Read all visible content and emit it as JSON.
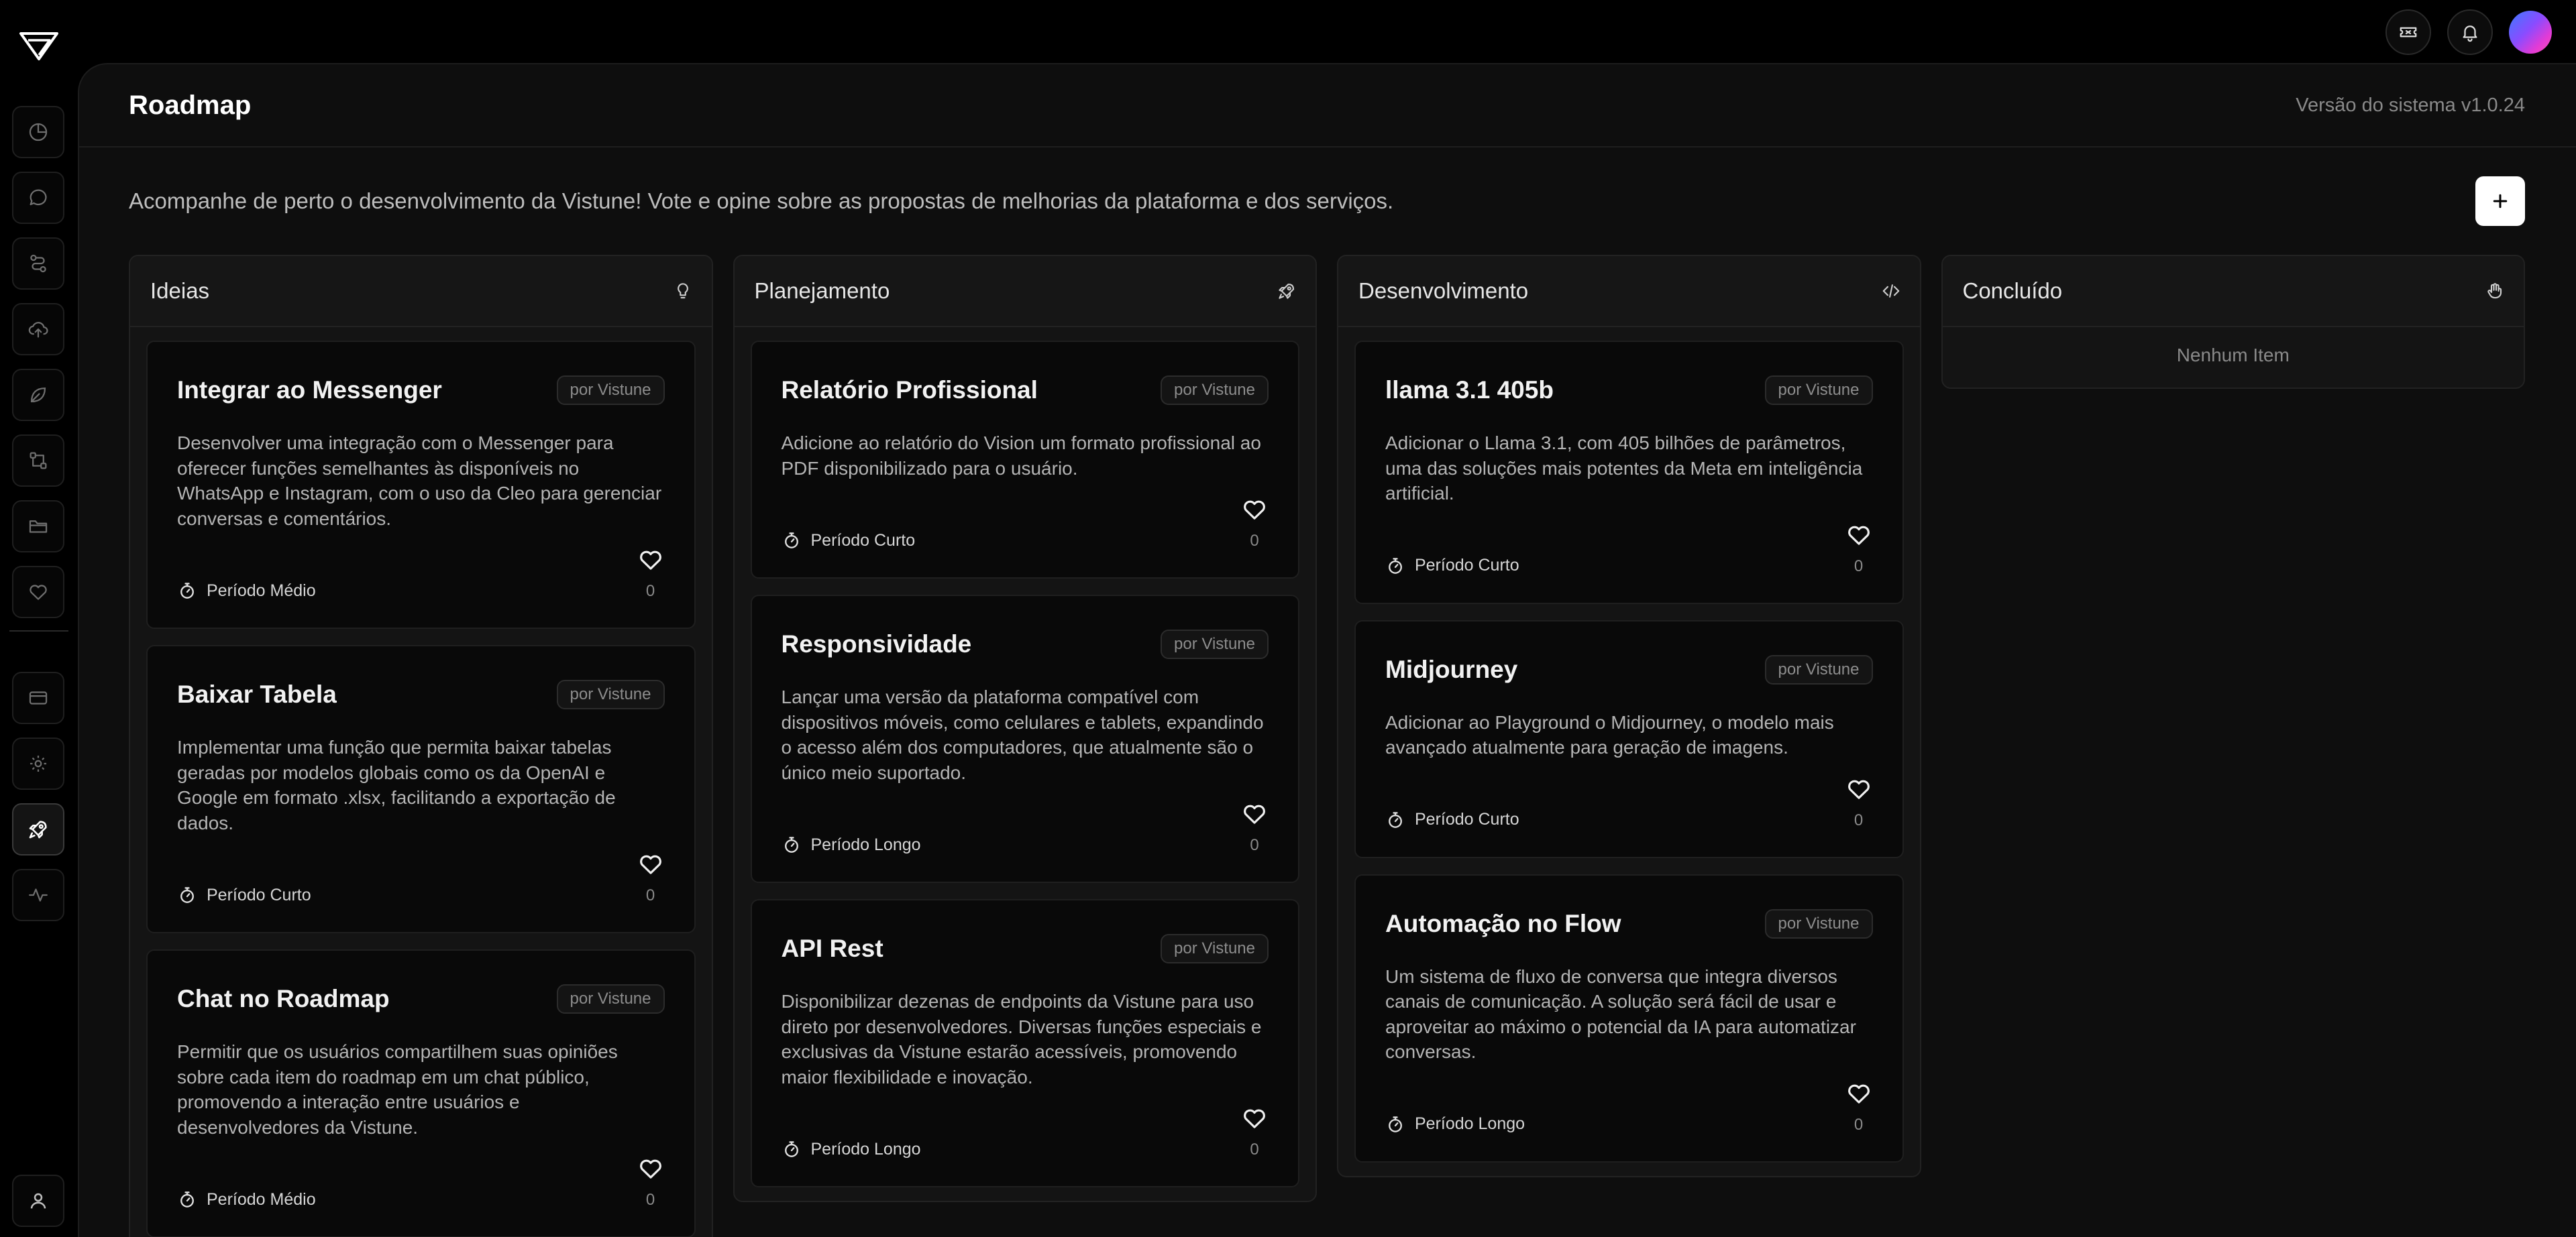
{
  "header": {
    "title": "Roadmap",
    "version": "Versão do sistema v1.0.24"
  },
  "intro": "Acompanhe de perto o desenvolvimento da Vistune! Vote e opine sobre as propostas de melhorias da plataforma e dos serviços.",
  "columns": [
    {
      "title": "Ideias",
      "icon": "lightbulb-icon",
      "empty_label": "",
      "cards": [
        {
          "title": "Integrar ao Messenger",
          "author": "por Vistune",
          "description": "Desenvolver uma integração com o Messenger para oferecer funções semelhantes às disponíveis no WhatsApp e Instagram, com o uso da Cleo para gerenciar conversas e comentários.",
          "period": "Período Médio",
          "votes": "0"
        },
        {
          "title": "Baixar Tabela",
          "author": "por Vistune",
          "description": "Implementar uma função que permita baixar tabelas geradas por modelos globais como os da OpenAI e Google em formato .xlsx, facilitando a exportação de dados.",
          "period": "Período Curto",
          "votes": "0"
        },
        {
          "title": "Chat no Roadmap",
          "author": "por Vistune",
          "description": "Permitir que os usuários compartilhem suas opiniões sobre cada item do roadmap em um chat público, promovendo a interação entre usuários e desenvolvedores da Vistune.",
          "period": "Período Médio",
          "votes": "0"
        }
      ]
    },
    {
      "title": "Planejamento",
      "icon": "rocket-icon",
      "empty_label": "",
      "cards": [
        {
          "title": "Relatório Profissional",
          "author": "por Vistune",
          "description": "Adicione ao relatório do Vision um formato profissional ao PDF disponibilizado para o usuário.",
          "period": "Período Curto",
          "votes": "0"
        },
        {
          "title": "Responsividade",
          "author": "por Vistune",
          "description": "Lançar uma versão da plataforma compatível com dispositivos móveis, como celulares e tablets, expandindo o acesso além dos computadores, que atualmente são o único meio suportado.",
          "period": "Período Longo",
          "votes": "0"
        },
        {
          "title": "API Rest",
          "author": "por Vistune",
          "description": "Disponibilizar dezenas de endpoints da Vistune para uso direto por desenvolvedores. Diversas funções especiais e exclusivas da Vistune estarão acessíveis, promovendo maior flexibilidade e inovação.",
          "period": "Período Longo",
          "votes": "0"
        }
      ]
    },
    {
      "title": "Desenvolvimento",
      "icon": "code-icon",
      "empty_label": "",
      "cards": [
        {
          "title": "llama 3.1 405b",
          "author": "por Vistune",
          "description": "Adicionar o Llama 3.1, com 405 bilhões de parâmetros, uma das soluções mais potentes da Meta em inteligência artificial.",
          "period": "Período Curto",
          "votes": "0"
        },
        {
          "title": "Midjourney",
          "author": "por Vistune",
          "description": "Adicionar ao Playground o Midjourney, o modelo mais avançado atualmente para geração de imagens.",
          "period": "Período Curto",
          "votes": "0"
        },
        {
          "title": "Automação no Flow",
          "author": "por Vistune",
          "description": "Um sistema de fluxo de conversa que integra diversos canais de comunicação. A solução será fácil de usar e aproveitar ao máximo o potencial da IA para automatizar conversas.",
          "period": "Período Longo",
          "votes": "0"
        }
      ]
    },
    {
      "title": "Concluído",
      "icon": "hand-icon",
      "empty_label": "Nenhum Item",
      "cards": []
    }
  ]
}
